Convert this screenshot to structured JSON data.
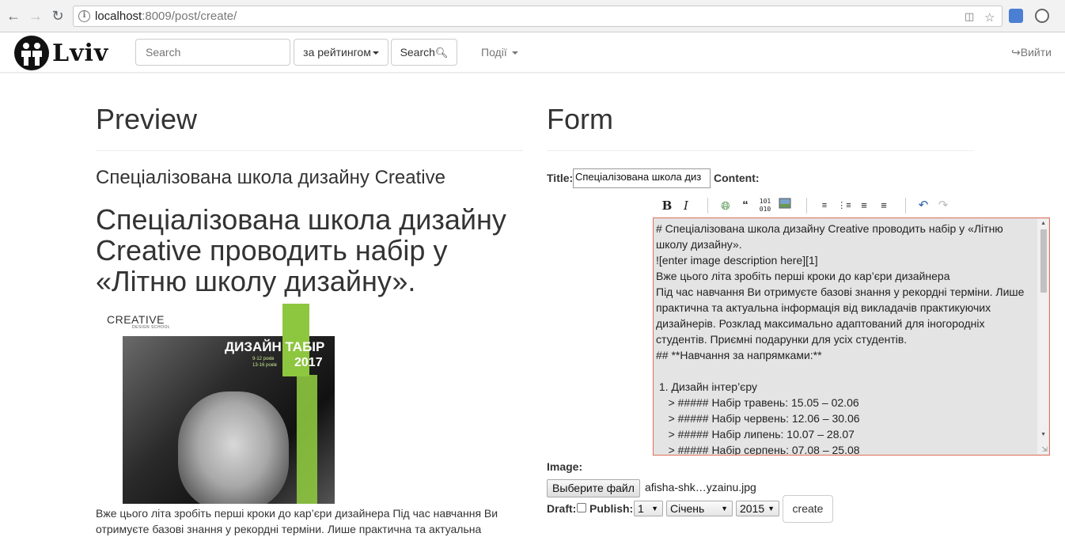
{
  "browser": {
    "url_host": "localhost",
    "url_rest": ":8009/post/create/",
    "back_icon": "arrow-left-icon",
    "forward_icon": "arrow-right-icon",
    "reload_icon": "reload-icon"
  },
  "navbar": {
    "logo_text": "Lviv",
    "search_placeholder": "Search",
    "sort_button": "за рейтингом",
    "search_button": "Search",
    "events_menu": "Події",
    "logout": "Вийти"
  },
  "preview": {
    "heading": "Preview",
    "post_title": "Спеціалізована школа дизайну Creative",
    "content_h1": "Спеціалізована школа дизайну Creative проводить набір у «Літню школу дизайну».",
    "poster": {
      "brand": "CREATIVE",
      "brand_sub": "DESIGN SCHOOL",
      "camp": "ДИЗАЙН ТАБІР",
      "ages1": "9-12 років",
      "ages2": "13-16 років",
      "year": "2017"
    },
    "body_text": "Вже цього літа зробіть перші кроки до кар’єри дизайнера Під час навчання Ви отримуєте базові знання у рекордні терміни. Лише практична та актуальна"
  },
  "form": {
    "heading": "Form",
    "title_label": "Title:",
    "title_value": "Спеціалізована школа диз",
    "content_label": "Content:",
    "editor_lines": [
      "# Спеціалізована школа дизайну Creative проводить набір у «Літню",
      "школу дизайну».",
      "![enter image description here][1]",
      "Вже цього літа зробіть перші кроки до кар’єри дизайнера",
      "Під час навчання Ви отримуєте базові знання у рекордні терміни. Лише",
      "практична та актуальна інформація від викладачів практикуючих",
      "дизайнерів. Розклад максимально адаптований для іногородніх",
      "студентів. Приємні подарунки для усіх студентів.",
      "## **Навчання за напрямками:**",
      "",
      " 1. Дизайн інтер’єру",
      "    > ##### Набір травень: 15.05 – 02.06",
      "    > ##### Набір червень: 12.06 – 30.06",
      "    > ##### Набір липень: 10.07 – 28.07",
      "    > ##### Набір серпень: 07.08 – 25.08"
    ],
    "image_label": "Image:",
    "file_button": "Выберите файл",
    "file_name": "afisha-shk…yzainu.jpg",
    "draft_label": "Draft:",
    "publish_label": "Publish:",
    "day": "1",
    "month": "Січень",
    "year": "2015",
    "create_button": "create"
  },
  "colors": {
    "editor_border": "#e0705a",
    "poster_green": "#8dc63f"
  }
}
